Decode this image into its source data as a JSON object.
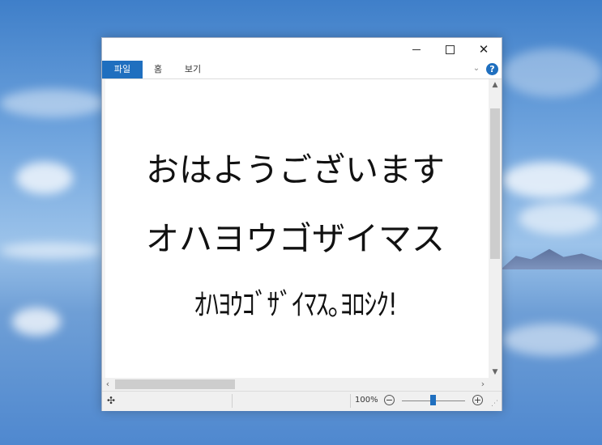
{
  "window": {
    "controls": {
      "minimize_icon": "minimize-icon",
      "maximize_icon": "maximize-icon",
      "close_label": "✕"
    }
  },
  "ribbon": {
    "tabs": [
      {
        "label": "파일",
        "active": true
      },
      {
        "label": "홈",
        "active": false
      },
      {
        "label": "보기",
        "active": false
      }
    ],
    "collapse_icon": "⌄",
    "help_label": "?"
  },
  "document": {
    "lines": [
      "おはようございます",
      "オハヨウゴザイマス",
      "ｵﾊﾖｳｺﾞｻﾞｲﾏｽ｡ﾖﾛｼｸ!"
    ]
  },
  "status": {
    "move_icon": "✣",
    "zoom_level": "100%",
    "zoom_out_label": "−",
    "zoom_in_label": "+",
    "zoom_slider_value": 0.5
  },
  "colors": {
    "accent": "#1f6fbf"
  }
}
